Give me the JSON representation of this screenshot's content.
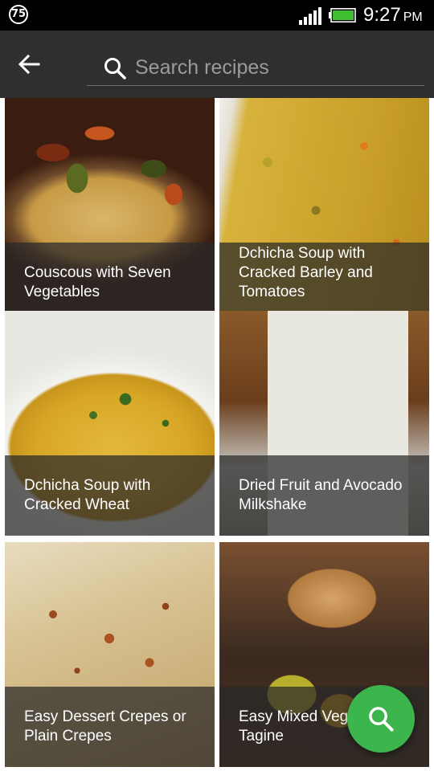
{
  "status_bar": {
    "notification_badge": "75",
    "time": "9:27",
    "ampm": "PM",
    "signal_icon": "signal-bars-icon",
    "battery_icon": "battery-icon",
    "battery_color": "#3fbf2f"
  },
  "app_bar": {
    "back_icon": "back-arrow-icon",
    "search_icon": "search-icon",
    "search_placeholder": "Search recipes",
    "search_value": ""
  },
  "recipes": [
    {
      "title": "Couscous with Seven Vegetables"
    },
    {
      "title": "Dchicha Soup with Cracked Barley and Tomatoes"
    },
    {
      "title": "Dchicha Soup with Cracked Wheat"
    },
    {
      "title": "Dried Fruit and Avocado Milkshake"
    },
    {
      "title": "Easy Dessert Crepes or Plain Crepes"
    },
    {
      "title": "Easy Mixed Vegetable Tagine"
    }
  ],
  "fab": {
    "icon": "search-icon",
    "color": "#3cb64c"
  }
}
